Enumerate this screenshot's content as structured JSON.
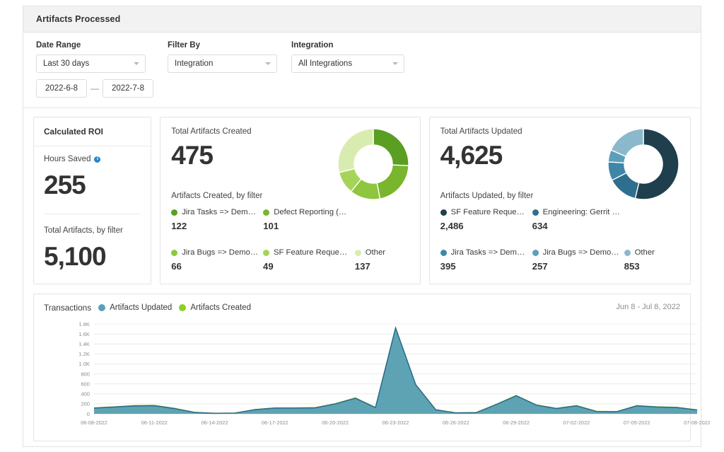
{
  "panel": {
    "title": "Artifacts Processed"
  },
  "filters": {
    "date_range": {
      "label": "Date Range",
      "value": "Last 30 days"
    },
    "filter_by": {
      "label": "Filter By",
      "value": "Integration"
    },
    "integration": {
      "label": "Integration",
      "value": "All Integrations"
    },
    "date_start": "2022-6-8",
    "date_end": "2022-7-8",
    "date_separator": "—"
  },
  "roi_card": {
    "title": "Calculated ROI",
    "hours_saved_label": "Hours Saved",
    "hours_saved_value": "255",
    "total_label": "Total Artifacts, by filter",
    "total_value": "5,100"
  },
  "created_card": {
    "title": "Total Artifacts Created",
    "value": "475",
    "byfilter_label": "Artifacts Created, by filter",
    "legend": [
      {
        "name": "Jira Tasks => Dem…",
        "value": "122",
        "color": "#5a9e22"
      },
      {
        "name": "Defect Reporting (…",
        "value": "101",
        "color": "#7ab52e"
      },
      {
        "name": "Jira Bugs => Demo…",
        "value": "66",
        "color": "#8ec63f"
      },
      {
        "name": "SF Feature Reque…",
        "value": "49",
        "color": "#a6d45a"
      },
      {
        "name": "Other",
        "value": "137",
        "color": "#d9ecb0"
      }
    ]
  },
  "updated_card": {
    "title": "Total Artifacts Updated",
    "value": "4,625",
    "byfilter_label": "Artifacts Updated, by filter",
    "legend": [
      {
        "name": "SF Feature Reque…",
        "value": "2,486",
        "color": "#1f3f4d"
      },
      {
        "name": "Engineering: Gerrit …",
        "value": "634",
        "color": "#2e6e8e"
      },
      {
        "name": "Jira Tasks => Dem…",
        "value": "395",
        "color": "#3f87a8"
      },
      {
        "name": "Jira Bugs => Demo…",
        "value": "257",
        "color": "#5ba0bb"
      },
      {
        "name": "Other",
        "value": "853",
        "color": "#8cb8cc"
      }
    ]
  },
  "chart_card": {
    "title": "Transactions",
    "range_label": "Jun 8 - Jul 8, 2022",
    "legend": [
      {
        "label": "Artifacts Updated",
        "color": "#5ba0bb"
      },
      {
        "label": "Artifacts Created",
        "color": "#8ed11e"
      }
    ]
  },
  "chart_data": {
    "type": "area",
    "title": "Transactions",
    "xlabel": "",
    "ylabel": "",
    "ylim": [
      0,
      1800
    ],
    "yticks": [
      "0",
      "200",
      "400",
      "600",
      "800",
      "1.0K",
      "1.2K",
      "1.4K",
      "1.6K",
      "1.8K"
    ],
    "ytick_values": [
      0,
      200,
      400,
      600,
      800,
      1000,
      1200,
      1400,
      1600,
      1800
    ],
    "grid": true,
    "legend_position": "top-left",
    "xticks": [
      "06-08-2022",
      "06-11-2022",
      "06-14-2022",
      "06-17-2022",
      "06-20-2022",
      "06-23-2022",
      "06-26-2022",
      "06-29-2022",
      "07-02-2022",
      "07-05-2022",
      "07-08-2022"
    ],
    "x": [
      "06-08-2022",
      "06-09-2022",
      "06-10-2022",
      "06-11-2022",
      "06-12-2022",
      "06-13-2022",
      "06-14-2022",
      "06-15-2022",
      "06-16-2022",
      "06-17-2022",
      "06-18-2022",
      "06-19-2022",
      "06-20-2022",
      "06-21-2022",
      "06-22-2022",
      "06-23-2022",
      "06-24-2022",
      "06-25-2022",
      "06-26-2022",
      "06-27-2022",
      "06-28-2022",
      "06-29-2022",
      "06-30-2022",
      "07-01-2022",
      "07-02-2022",
      "07-03-2022",
      "07-04-2022",
      "07-05-2022",
      "07-06-2022",
      "07-07-2022",
      "07-08-2022"
    ],
    "series": [
      {
        "name": "Artifacts Created",
        "color": "#8ed11e",
        "values": [
          130,
          150,
          175,
          180,
          120,
          40,
          20,
          25,
          95,
          130,
          130,
          135,
          215,
          330,
          140,
          1740,
          600,
          95,
          30,
          35,
          200,
          380,
          190,
          120,
          175,
          60,
          55,
          175,
          150,
          140,
          90
        ]
      },
      {
        "name": "Artifacts Updated",
        "color": "#5ba0bb",
        "values": [
          115,
          135,
          158,
          163,
          105,
          28,
          10,
          14,
          82,
          115,
          115,
          120,
          198,
          312,
          125,
          1720,
          585,
          80,
          18,
          22,
          185,
          362,
          175,
          105,
          160,
          46,
          42,
          160,
          135,
          125,
          76
        ]
      }
    ]
  },
  "donuts": {
    "created": {
      "slices": [
        {
          "name": "Jira Tasks => Dem…",
          "value": 122,
          "color": "#5a9e22"
        },
        {
          "name": "Defect Reporting (…",
          "value": 101,
          "color": "#7ab52e"
        },
        {
          "name": "Jira Bugs => Demo…",
          "value": 66,
          "color": "#8ec63f"
        },
        {
          "name": "SF Feature Reque…",
          "value": 49,
          "color": "#a6d45a"
        },
        {
          "name": "Other",
          "value": 137,
          "color": "#d9ecb0"
        }
      ]
    },
    "updated": {
      "slices": [
        {
          "name": "SF Feature Reque…",
          "value": 2486,
          "color": "#1f3f4d"
        },
        {
          "name": "Engineering: Gerrit …",
          "value": 634,
          "color": "#2e6e8e"
        },
        {
          "name": "Jira Tasks => Dem…",
          "value": 395,
          "color": "#3f87a8"
        },
        {
          "name": "Jira Bugs => Demo…",
          "value": 257,
          "color": "#5ba0bb"
        },
        {
          "name": "Other",
          "value": 853,
          "color": "#8cb8cc"
        }
      ]
    }
  }
}
